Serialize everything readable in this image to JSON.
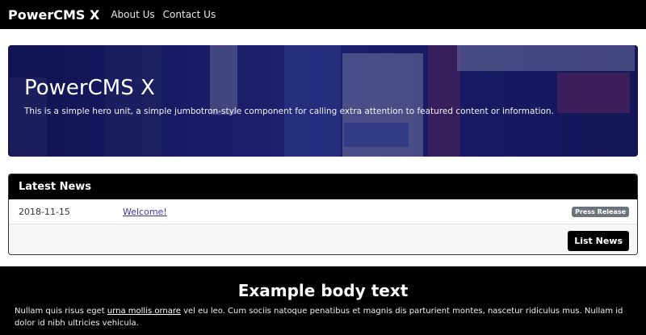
{
  "navbar": {
    "brand": "PowerCMS X",
    "links": [
      "About Us",
      "Contact Us"
    ]
  },
  "hero": {
    "title": "PowerCMS X",
    "lead": "This is a simple hero unit, a simple jumbotron-style component for calling extra attention to featured content or information."
  },
  "news": {
    "header": "Latest News",
    "items": [
      {
        "date": "2018-11-15",
        "title": "Welcome!",
        "badge": "Press Release"
      }
    ],
    "list_button": "List News"
  },
  "body": {
    "heading": "Example body text",
    "text_before": "Nullam quis risus eget ",
    "link_text": "urna mollis ornare",
    "text_after": " vel eu leo. Cum sociis natoque penatibus et magnis dis parturient montes, nascetur ridiculus mus. Nullam id dolor id nibh ultricies vehicula."
  },
  "colors": {
    "navbar_bg": "#000000",
    "hero_overlay": "#14165a",
    "link": "#3a3aa0",
    "badge": "#6c757d"
  }
}
